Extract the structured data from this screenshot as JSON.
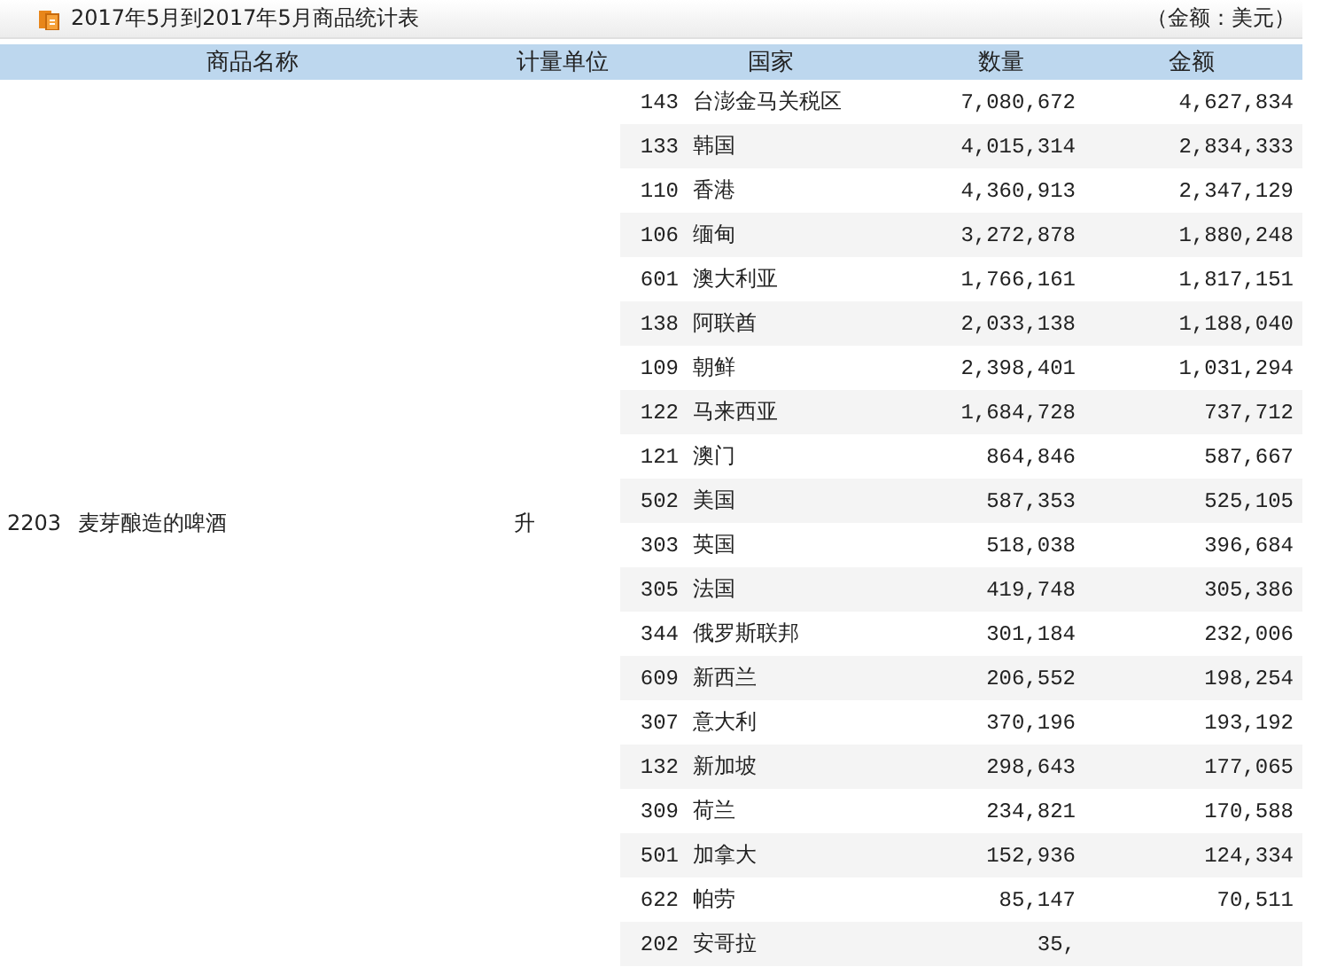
{
  "title": "2017年5月到2017年5月商品统计表",
  "unit_note": "（金额：美元）",
  "columns": [
    "商品名称",
    "计量单位",
    "国家",
    "数量",
    "金额"
  ],
  "product": {
    "code": "2203",
    "name": "麦芽酿造的啤酒",
    "unit": "升"
  },
  "rows": [
    {
      "code": "143",
      "country": "台澎金马关税区",
      "quantity": "7,080,672",
      "amount": "4,627,834"
    },
    {
      "code": "133",
      "country": "韩国",
      "quantity": "4,015,314",
      "amount": "2,834,333"
    },
    {
      "code": "110",
      "country": "香港",
      "quantity": "4,360,913",
      "amount": "2,347,129"
    },
    {
      "code": "106",
      "country": "缅甸",
      "quantity": "3,272,878",
      "amount": "1,880,248"
    },
    {
      "code": "601",
      "country": "澳大利亚",
      "quantity": "1,766,161",
      "amount": "1,817,151"
    },
    {
      "code": "138",
      "country": "阿联酋",
      "quantity": "2,033,138",
      "amount": "1,188,040"
    },
    {
      "code": "109",
      "country": "朝鲜",
      "quantity": "2,398,401",
      "amount": "1,031,294"
    },
    {
      "code": "122",
      "country": "马来西亚",
      "quantity": "1,684,728",
      "amount": "737,712"
    },
    {
      "code": "121",
      "country": "澳门",
      "quantity": "864,846",
      "amount": "587,667"
    },
    {
      "code": "502",
      "country": "美国",
      "quantity": "587,353",
      "amount": "525,105"
    },
    {
      "code": "303",
      "country": "英国",
      "quantity": "518,038",
      "amount": "396,684"
    },
    {
      "code": "305",
      "country": "法国",
      "quantity": "419,748",
      "amount": "305,386"
    },
    {
      "code": "344",
      "country": "俄罗斯联邦",
      "quantity": "301,184",
      "amount": "232,006"
    },
    {
      "code": "609",
      "country": "新西兰",
      "quantity": "206,552",
      "amount": "198,254"
    },
    {
      "code": "307",
      "country": "意大利",
      "quantity": "370,196",
      "amount": "193,192"
    },
    {
      "code": "132",
      "country": "新加坡",
      "quantity": "298,643",
      "amount": "177,065"
    },
    {
      "code": "309",
      "country": "荷兰",
      "quantity": "234,821",
      "amount": "170,588"
    },
    {
      "code": "501",
      "country": "加拿大",
      "quantity": "152,936",
      "amount": "124,334"
    },
    {
      "code": "622",
      "country": "帕劳",
      "quantity": "85,147",
      "amount": "70,511"
    },
    {
      "code": "202",
      "country": "安哥拉",
      "quantity": "35,"
    }
  ]
}
